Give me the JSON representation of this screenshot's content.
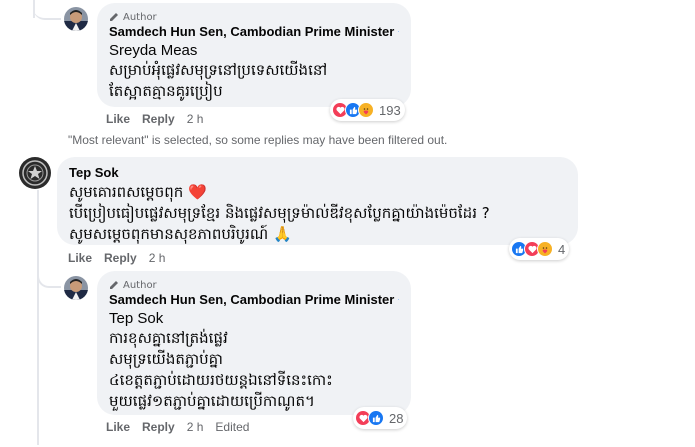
{
  "comments": [
    {
      "id": "reply-1",
      "badge": "Author",
      "name": "Samdech Hun Sen, Cambodian Prime Minister",
      "mention": "Sreyda Meas",
      "lines": [
        "សម្រាប់អុំផ្លេវសមុទ្រនៅប្រទេសយើងនៅ",
        "តែស្អាតគ្មានគូរប្រៀប"
      ],
      "reaction_count": "193",
      "actions": {
        "like": "Like",
        "reply": "Reply",
        "time": "2 h"
      }
    },
    {
      "id": "comment-2",
      "name": "Tep Sok",
      "lines": [
        "សូមគោរពសម្តេចពុក ❤️",
        "បើប្រៀបធៀបផ្លេវសមុទ្រខ្មែរ និងផ្លេវសមុទ្រម៉ាល់ឌីវខុសប្លែកគ្នាយ៉ាងម៉េចដែរ ?",
        "សូមសម្ដេចពុកមានសុខភាពបរិបូរណ៍ 🙏"
      ],
      "reaction_count": "4",
      "actions": {
        "like": "Like",
        "reply": "Reply",
        "time": "2 h"
      }
    },
    {
      "id": "reply-3",
      "badge": "Author",
      "name": "Samdech Hun Sen, Cambodian Prime Minister",
      "mention": "Tep Sok",
      "lines": [
        "ការខុសគ្នានៅត្រង់ផ្លេវ",
        "សមុទ្រយើងតភ្ជាប់គ្នា",
        "៤ខេត្តតភ្ជាប់ដោយរថយន្តឯនៅទីនេះកោះ",
        "មួយផ្លេវ១តភ្ជាប់គ្នាដោយប្រើកាណូត។"
      ],
      "reaction_count": "28",
      "actions": {
        "like": "Like",
        "reply": "Reply",
        "time": "2 h",
        "edited": "Edited"
      }
    }
  ],
  "filter_notice": "\"Most relevant\" is selected, so some replies may have been filtered out.",
  "colors": {
    "bubble": "#f0f2f5",
    "meta": "#65676b",
    "like_blue": "#1877f2",
    "love_red": "#f33e58",
    "care_yellow": "#f7b125"
  }
}
